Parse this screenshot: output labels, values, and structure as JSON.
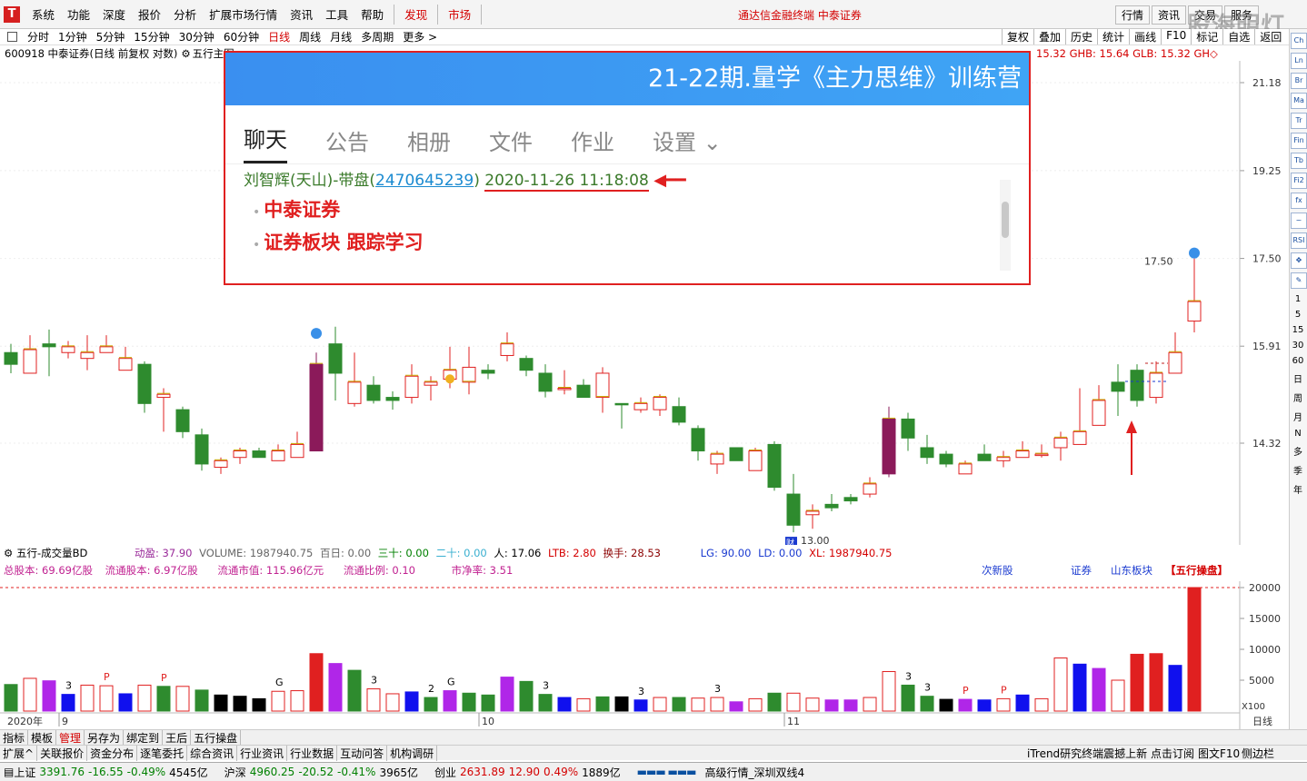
{
  "menu": {
    "logo": "T",
    "items": [
      "系统",
      "功能",
      "深度",
      "报价",
      "分析",
      "扩展市场行情",
      "资讯",
      "工具",
      "帮助"
    ],
    "red_items": [
      "发现",
      "市场"
    ],
    "center_title": "通达信金融终端 中泰证券",
    "right_buttons": [
      "行情",
      "资讯",
      "交易",
      "服务"
    ]
  },
  "watermark": "股海明灯",
  "periods": {
    "items": [
      "分时",
      "1分钟",
      "5分钟",
      "15分钟",
      "30分钟",
      "60分钟",
      "日线",
      "周线",
      "月线",
      "多周期",
      "更多 >"
    ],
    "active_index": 6,
    "right_tools": [
      "复权",
      "叠加",
      "历史",
      "统计",
      "画线",
      "F10",
      "标记",
      "自选",
      "返回"
    ]
  },
  "info": {
    "stock": "600918 中泰证券(日线 前复权 对数)",
    "indicator": "五行主图",
    "right_text": "15.32 GHB: 15.64 GLB: 15.32 GH◇"
  },
  "overlay": {
    "title": "21-22期.量学《主力思维》训练营",
    "tabs": [
      "聊天",
      "公告",
      "相册",
      "文件",
      "作业",
      "设置 ⌄"
    ],
    "sender": "刘智辉(天山)-带盘(",
    "qq": "2470645239",
    "sender_end": ")",
    "timestamp": "2020-11-26 11:18:08",
    "bullets": [
      "中泰证券",
      "证券板块 跟踪学习"
    ]
  },
  "chart_data": {
    "type": "candlestick",
    "price_ticks": [
      "21.18",
      "19.25",
      "17.50",
      "15.91",
      "14.32"
    ],
    "price_tick_values": [
      21.18,
      19.25,
      17.5,
      15.91,
      14.32
    ],
    "annotations": {
      "high": "17.50",
      "low": "13.00",
      "low_marker": "财"
    },
    "candles": [
      [
        15.8,
        15.95,
        15.45,
        15.6
      ],
      [
        15.45,
        16.1,
        15.6,
        15.85
      ],
      [
        15.9,
        16.2,
        15.4,
        15.95
      ],
      [
        15.8,
        16.0,
        15.7,
        15.9
      ],
      [
        15.7,
        16.1,
        15.5,
        15.8
      ],
      [
        15.8,
        16.1,
        15.85,
        15.9
      ],
      [
        15.5,
        15.9,
        15.5,
        15.7
      ],
      [
        15.6,
        15.65,
        14.8,
        14.95
      ],
      [
        15.05,
        15.2,
        14.5,
        15.1
      ],
      [
        14.85,
        14.9,
        14.4,
        14.5
      ],
      [
        14.45,
        14.55,
        13.9,
        14.0
      ],
      [
        13.95,
        14.1,
        13.85,
        14.05
      ],
      [
        14.1,
        14.25,
        14.0,
        14.2
      ],
      [
        14.2,
        14.25,
        14.1,
        14.1
      ],
      [
        14.05,
        14.3,
        14.05,
        14.2
      ],
      [
        14.1,
        14.5,
        14.1,
        14.3
      ],
      [
        14.2,
        15.8,
        14.2,
        15.6
      ],
      [
        15.45,
        16.25,
        15.0,
        15.95
      ],
      [
        14.95,
        15.8,
        14.9,
        15.3
      ],
      [
        15.25,
        15.4,
        14.95,
        15.0
      ],
      [
        15.0,
        15.15,
        14.85,
        15.05
      ],
      [
        15.05,
        15.6,
        14.95,
        15.4
      ],
      [
        15.25,
        15.4,
        15.0,
        15.3
      ],
      [
        15.35,
        15.9,
        15.2,
        15.5
      ],
      [
        15.55,
        15.9,
        15.1,
        15.3
      ],
      [
        15.5,
        15.6,
        15.35,
        15.45
      ],
      [
        15.75,
        16.15,
        15.65,
        15.95
      ],
      [
        15.7,
        15.75,
        15.4,
        15.5
      ],
      [
        15.45,
        15.6,
        15.05,
        15.15
      ],
      [
        15.2,
        15.5,
        15.1,
        15.2
      ],
      [
        15.05,
        15.35,
        15.05,
        15.25
      ],
      [
        15.45,
        15.55,
        14.8,
        15.05
      ],
      [
        14.95,
        14.95,
        14.55,
        14.95
      ],
      [
        14.85,
        15.05,
        14.8,
        14.95
      ],
      [
        14.85,
        15.1,
        14.75,
        15.05
      ],
      [
        14.9,
        15.05,
        14.6,
        14.65
      ],
      [
        14.55,
        14.6,
        14.05,
        14.2
      ],
      [
        14.0,
        14.2,
        13.85,
        14.15
      ],
      [
        14.05,
        14.25,
        14.05,
        14.25
      ],
      [
        13.9,
        14.25,
        13.9,
        14.2
      ],
      [
        14.3,
        14.35,
        13.6,
        13.65
      ],
      [
        13.55,
        13.85,
        13.0,
        13.1
      ],
      [
        13.25,
        13.4,
        13.05,
        13.3
      ],
      [
        13.35,
        13.55,
        13.3,
        13.4
      ],
      [
        13.5,
        13.55,
        13.4,
        13.45
      ],
      [
        13.55,
        13.8,
        13.5,
        13.7
      ],
      [
        13.85,
        14.9,
        13.8,
        14.7
      ],
      [
        14.7,
        14.8,
        14.2,
        14.4
      ],
      [
        14.25,
        14.45,
        14.0,
        14.1
      ],
      [
        14.15,
        14.2,
        13.95,
        14.0
      ],
      [
        13.85,
        14.05,
        13.9,
        14.0
      ],
      [
        14.05,
        14.3,
        14.05,
        14.15
      ],
      [
        14.05,
        14.2,
        13.95,
        14.1
      ],
      [
        14.1,
        14.35,
        14.1,
        14.2
      ],
      [
        14.15,
        14.3,
        14.1,
        14.15
      ],
      [
        14.25,
        14.5,
        14.05,
        14.4
      ],
      [
        14.3,
        15.2,
        14.3,
        14.5
      ],
      [
        14.6,
        15.25,
        14.6,
        15.0
      ],
      [
        15.15,
        15.6,
        14.75,
        15.3
      ],
      [
        15.5,
        15.6,
        14.9,
        15.0
      ],
      [
        15.05,
        15.65,
        14.95,
        15.45
      ],
      [
        15.45,
        16.15,
        15.5,
        15.8
      ],
      [
        16.35,
        17.5,
        16.15,
        16.7
      ]
    ],
    "candle_colors": [
      "g",
      "r",
      "g",
      "r",
      "r",
      "r",
      "r",
      "g",
      "r",
      "g",
      "g",
      "r",
      "r",
      "g",
      "r",
      "r",
      "p",
      "g",
      "r",
      "g",
      "g",
      "r",
      "r",
      "r",
      "r",
      "g",
      "r",
      "g",
      "g",
      "r",
      "g",
      "r",
      "g",
      "r",
      "r",
      "g",
      "g",
      "r",
      "g",
      "r",
      "g",
      "g",
      "r",
      "g",
      "g",
      "r",
      "p",
      "g",
      "g",
      "g",
      "r",
      "g",
      "r",
      "r",
      "r",
      "r",
      "r",
      "r",
      "g",
      "g",
      "r",
      "r",
      "r"
    ],
    "volume_ticks": [
      "20000",
      "15000",
      "10000",
      "5000"
    ],
    "volume_tick_values": [
      20000,
      15000,
      10000,
      5000
    ],
    "volume_max": 20000,
    "volumes": [
      4300,
      5300,
      4900,
      2700,
      4200,
      4100,
      2800,
      4200,
      4000,
      4000,
      3400,
      2600,
      2400,
      2000,
      3200,
      3300,
      9300,
      7700,
      6600,
      3600,
      2800,
      3100,
      2200,
      3300,
      2900,
      2600,
      5500,
      4800,
      2700,
      2200,
      2000,
      2300,
      2300,
      1800,
      2200,
      2200,
      2100,
      2200,
      1500,
      2000,
      2900,
      2900,
      2100,
      1800,
      1800,
      2200,
      6400,
      4200,
      2400,
      1900,
      1900,
      1800,
      2000,
      2600,
      2000,
      8600,
      7600,
      6900,
      5000,
      9200,
      9300,
      7400,
      20000
    ],
    "volume_colors": [
      "g",
      "r",
      "p",
      "b",
      "r",
      "r",
      "b",
      "r",
      "g",
      "r",
      "g",
      "k",
      "k",
      "k",
      "r",
      "r",
      "r",
      "p",
      "g",
      "r",
      "r",
      "b",
      "g",
      "p",
      "g",
      "g",
      "p",
      "g",
      "g",
      "b",
      "r",
      "g",
      "k",
      "b",
      "r",
      "g",
      "r",
      "r",
      "p",
      "r",
      "g",
      "r",
      "r",
      "p",
      "p",
      "r",
      "r",
      "g",
      "g",
      "k",
      "p",
      "b",
      "r",
      "b",
      "r",
      "r",
      "b",
      "p",
      "r",
      "r",
      "r",
      "b",
      "r"
    ],
    "volume_labels": [
      {
        "i": 3,
        "t": "3"
      },
      {
        "i": 5,
        "t": "P"
      },
      {
        "i": 8,
        "t": "P"
      },
      {
        "i": 14,
        "t": "G"
      },
      {
        "i": 19,
        "t": "3"
      },
      {
        "i": 22,
        "t": "2"
      },
      {
        "i": 23,
        "t": "G"
      },
      {
        "i": 28,
        "t": "3"
      },
      {
        "i": 33,
        "t": "3"
      },
      {
        "i": 37,
        "t": "3"
      },
      {
        "i": 47,
        "t": "3"
      },
      {
        "i": 48,
        "t": "3"
      },
      {
        "i": 50,
        "t": "P"
      },
      {
        "i": 52,
        "t": "P"
      }
    ],
    "date_labels": [
      {
        "i": 3,
        "t": "9"
      },
      {
        "i": 25,
        "t": "10"
      },
      {
        "i": 41,
        "t": "11"
      }
    ],
    "year_label": "2020年",
    "x100": "X100",
    "period_label": "日线"
  },
  "volume_head": {
    "name": "五行-成交量BD",
    "dong": "动盈: 37.90",
    "volume": "VOLUME: 1987940.75",
    "baiRi": "百日: 0.00",
    "sanShi": "三十: 0.00",
    "erShi": "二十: 0.00",
    "ren": "人: 17.06",
    "ltb": "LTB: 2.80",
    "hs": "换手: 28.53",
    "lg": "LG: 90.00",
    "ld": "LD: 0.00",
    "xl": "XL: 1987940.75"
  },
  "volume_info": {
    "items": [
      "总股本: 69.69亿股",
      "流通股本: 6.97亿股",
      "流通市值: 115.96亿元",
      "流通比例: 0.10",
      "市净率: 3.51"
    ],
    "tags": [
      "次新股",
      "证券",
      "山东板块"
    ],
    "tag_red": "【五行操盘】"
  },
  "tabs1": {
    "items": [
      "指标",
      "模板",
      "管理",
      "另存为",
      "绑定到",
      "王后",
      "五行操盘"
    ],
    "active_index": 2
  },
  "tabs2": {
    "items": [
      "扩展^",
      "关联报价",
      "资金分布",
      "逐笔委托",
      "综合资讯",
      "行业资讯",
      "行业数据",
      "互动问答",
      "机构调研"
    ],
    "right": "iTrend研究终端震撼上新 点击订阅",
    "right2": "图文F10",
    "right3": "侧边栏"
  },
  "status": {
    "sh_name": "上证",
    "sh_val": "3391.76",
    "sh_chg": "-16.55",
    "sh_pct": "-0.49%",
    "sh_amt": "4545亿",
    "sz_name": "沪深",
    "sz_val": "4960.25",
    "sz_chg": "-20.52",
    "sz_pct": "-0.41%",
    "sz_amt": "3965亿",
    "cy_name": "创业",
    "cy_val": "2631.89",
    "cy_chg": "12.90",
    "cy_pct": "0.49%",
    "cy_amt": "1889亿",
    "right": "高级行情_深圳双线4"
  },
  "sidebar": {
    "icons": [
      "chart-icon",
      "line-icon",
      "bar-icon",
      "candle-icon",
      "trend-icon",
      "fin-icon",
      "table-icon",
      "fi2-icon",
      "fix-icon",
      "rsi-icon",
      "rsi2-icon",
      "move-icon",
      "pen-icon"
    ],
    "labels": [
      "Ch",
      "Ln",
      "Br",
      "Ma",
      "Tr",
      "Fin",
      "Tb",
      "Fi2",
      "fx",
      "~",
      "RSI",
      "✥",
      "✎"
    ],
    "nums": [
      "1",
      "5",
      "15",
      "30",
      "60",
      "日",
      "周",
      "月",
      "N",
      "多",
      "季",
      "年"
    ]
  },
  "colors": {
    "up": "#e02020",
    "down": "#2e8b2e",
    "purple": "#8b1a5a",
    "blue": "#1010ee",
    "black": "#000000",
    "violet": "#b026e8"
  }
}
